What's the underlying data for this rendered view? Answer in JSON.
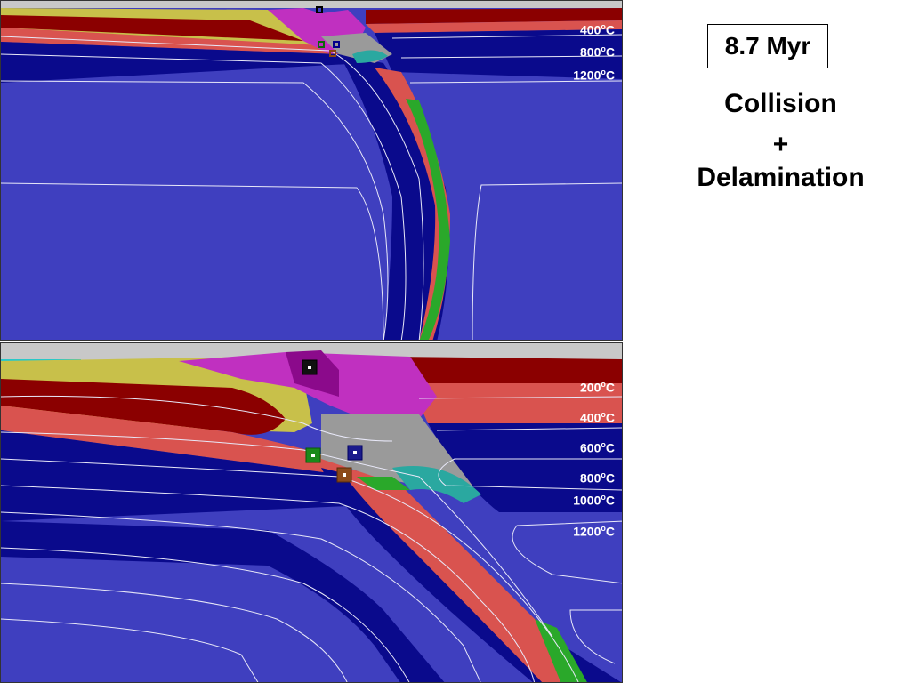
{
  "time_label": "8.7 Myr",
  "caption": {
    "line1": "Collision",
    "line2": "+",
    "line3": "Delamination"
  },
  "top_panel": {
    "isotherms": [
      {
        "value": "400",
        "unit": "oC"
      },
      {
        "value": "800",
        "unit": "oC"
      },
      {
        "value": "1200",
        "unit": "oC"
      }
    ]
  },
  "bottom_panel": {
    "isotherms": [
      {
        "value": "200",
        "unit": "oC"
      },
      {
        "value": "400",
        "unit": "oC"
      },
      {
        "value": "600",
        "unit": "oC"
      },
      {
        "value": "800",
        "unit": "oC"
      },
      {
        "value": "1000",
        "unit": "oC"
      },
      {
        "value": "1200",
        "unit": "oC"
      }
    ]
  },
  "colors": {
    "mantle_light": "#3f3fbf",
    "mantle_dark": "#0a0a8c",
    "crust_red": "#d9534f",
    "crust_dark_red": "#8b0000",
    "sediment_yellow": "#c8c04a",
    "magenta": "#c030c0",
    "teal": "#2aa8a0",
    "green": "#2aa82a",
    "gray": "#9a9a9a",
    "air": "#c8c8c8"
  }
}
